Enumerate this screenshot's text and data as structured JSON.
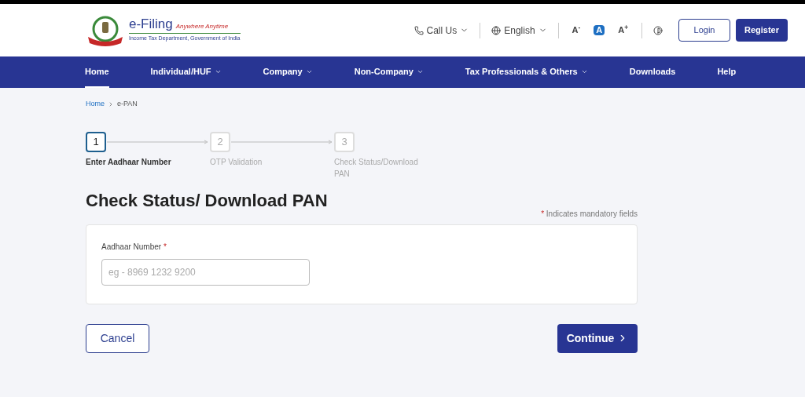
{
  "logo": {
    "title": "e-Filing",
    "tagline": "Anywhere Anytime",
    "subtitle": "Income Tax Department, Government of India"
  },
  "top_bar": {
    "call": {
      "label": "Call Us"
    },
    "language": {
      "label": "English"
    },
    "font_sizes": [
      {
        "label": "A$^{-}$",
        "selected": false
      },
      {
        "label": "A",
        "selected": true
      },
      {
        "label": "A$^{+}$",
        "selected": false
      }
    ],
    "buttons": [
      {
        "label": "Login",
        "kind": "outline"
      },
      {
        "label": "Register",
        "kind": "solid"
      }
    ]
  },
  "nav": [
    {
      "label": "Home",
      "selected": true,
      "dropdown": false
    },
    {
      "label": "Individual/HUF",
      "selected": false,
      "dropdown": true
    },
    {
      "label": "Company",
      "selected": false,
      "dropdown": true
    },
    {
      "label": "Non-Company",
      "selected": false,
      "dropdown": true
    },
    {
      "label": "Tax Professionals & Others",
      "selected": false,
      "dropdown": true
    },
    {
      "label": "Downloads",
      "selected": false,
      "dropdown": false
    },
    {
      "label": "Help",
      "selected": false,
      "dropdown": false
    }
  ],
  "breadcrumb": [
    {
      "label": "Home",
      "link": true
    },
    {
      "label": "e-PAN",
      "link": false
    }
  ],
  "steps": [
    {
      "number": "1",
      "label": "Enter Aadhaar Number",
      "selected": true
    },
    {
      "number": "2",
      "label": "OTP Validation",
      "selected": false
    },
    {
      "number": "3",
      "label": "Check Status/Download PAN",
      "selected": false
    }
  ],
  "title": "Check Status/ Download PAN",
  "mandatory_note": {
    "mark": "*",
    "text": "Indicates mandatory fields"
  },
  "form": {
    "fields": [
      {
        "label": "Aadhaar Number",
        "required_mark": "*",
        "placeholder": "eg - 8969 1232 9200"
      }
    ]
  },
  "actions": [
    {
      "label": "Cancel",
      "kind": "outline"
    },
    {
      "label": "Continue",
      "kind": "solid"
    }
  ]
}
